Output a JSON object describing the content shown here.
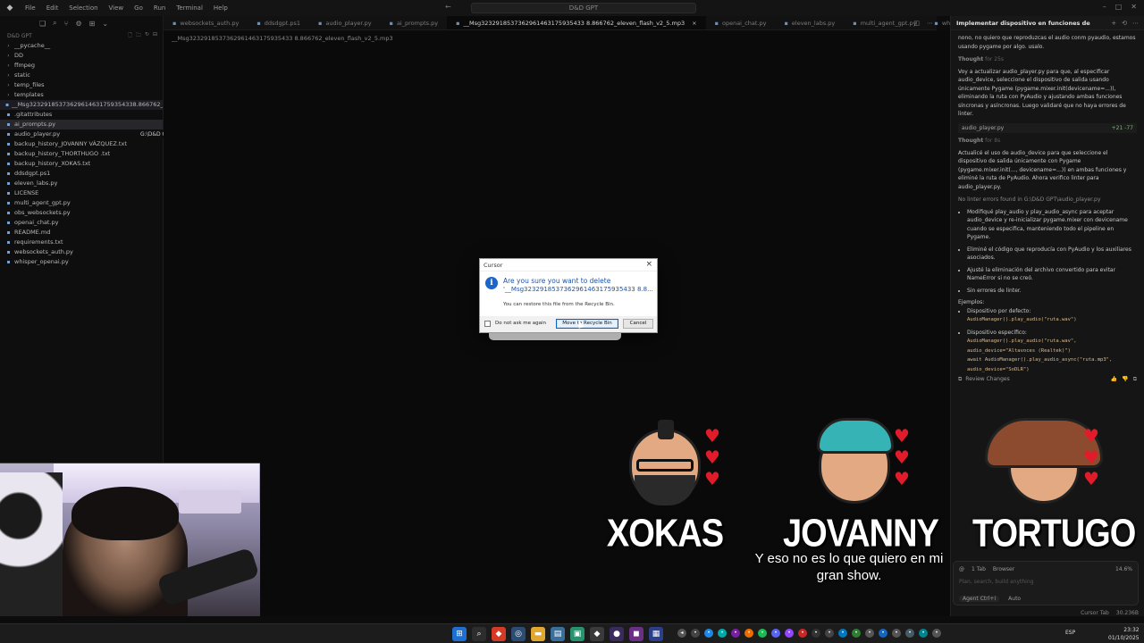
{
  "titlebar": {
    "menu": [
      "File",
      "Edit",
      "Selection",
      "View",
      "Go",
      "Run",
      "Terminal",
      "Help"
    ],
    "search": "D&D GPT"
  },
  "sidebar": {
    "header": "D&D GPT",
    "items": [
      {
        "label": "__pycache__",
        "type": "folder"
      },
      {
        "label": "DD",
        "type": "folder"
      },
      {
        "label": "ffmpeg",
        "type": "folder"
      },
      {
        "label": "static",
        "type": "folder"
      },
      {
        "label": "temp_files",
        "type": "folder"
      },
      {
        "label": "templates",
        "type": "folder"
      },
      {
        "label": "__Msg32329185373629614631759354338.866762_elev...",
        "type": "file",
        "state": "hl"
      },
      {
        "label": ".gitattributes",
        "type": "file"
      },
      {
        "label": "ai_prompts.py",
        "type": "file",
        "state": "sel"
      },
      {
        "label": "audio_player.py",
        "type": "file"
      },
      {
        "label": "backup_history_JOVANNY VÁZQUEZ.txt",
        "type": "file"
      },
      {
        "label": "backup_history_THORTHUGO .txt",
        "type": "file"
      },
      {
        "label": "backup_history_XOKAS.txt",
        "type": "file"
      },
      {
        "label": "ddsdgpt.ps1",
        "type": "file"
      },
      {
        "label": "eleven_labs.py",
        "type": "file"
      },
      {
        "label": "LICENSE",
        "type": "file"
      },
      {
        "label": "multi_agent_gpt.py",
        "type": "file"
      },
      {
        "label": "obs_websockets.py",
        "type": "file"
      },
      {
        "label": "openai_chat.py",
        "type": "file"
      },
      {
        "label": "README.md",
        "type": "file"
      },
      {
        "label": "requirements.txt",
        "type": "file"
      },
      {
        "label": "websockets_auth.py",
        "type": "file"
      },
      {
        "label": "whisper_openai.py",
        "type": "file"
      }
    ],
    "path_tooltip": "G:\\D&D GPT\\ai_prompts.py"
  },
  "tabs": [
    {
      "label": "websockets_auth.py",
      "active": false
    },
    {
      "label": "ddsdgpt.ps1",
      "active": false
    },
    {
      "label": "audio_player.py",
      "active": false
    },
    {
      "label": "ai_prompts.py",
      "active": false
    },
    {
      "label": "__Msg3232918537362961463175935433 8.866762_eleven_flash_v2_5.mp3",
      "active": true
    },
    {
      "label": "openai_chat.py",
      "active": false
    },
    {
      "label": "eleven_labs.py",
      "active": false
    },
    {
      "label": "multi_agent_gpt.py",
      "active": false
    },
    {
      "label": "whisper_openai.py",
      "active": false
    }
  ],
  "editor": {
    "breadcrumb": "__Msg3232918537362961463175935433 8.866762_eleven_flash_v2_5.mp3"
  },
  "dialog": {
    "title": "Cursor",
    "question": "Are you sure you want to delete",
    "filename": "'__Msg3232918537362961463175935433 8.8...",
    "note": "You can restore this file from the Recycle Bin.",
    "checkbox_label": "Do not ask me again",
    "primary_button": "Move to Recycle Bin",
    "cancel_button": "Cancel"
  },
  "chat": {
    "title": "Implementar dispositivo en funciones de au",
    "user_msg": "nono, no quiero que reproduzcas el audio conm pyaudio, estamos usando pygame por algo. usalo.",
    "thought1": "Thought",
    "thought1_time": "for 25s",
    "p1": "Voy a actualizar audio_player.py para que, al especificar audio_device, seleccione el dispositivo de salida usando únicamente Pygame (pygame.mixer.init(devicename=...)), eliminando la ruta con PyAudio y ajustando ambas funciones síncronas y asíncronas. Luego validaré que no haya errores de linter.",
    "file_pill": "audio_player.py",
    "file_diff": "+21 -77",
    "thought2": "Thought",
    "thought2_time": "for 8s",
    "p2": "Actualicé el uso de audio_device para que seleccione el dispositivo de salida únicamente con Pygame (pygame.mixer.init(..., devicename=...)) en ambas funciones y eliminé la ruta de PyAudio. Ahora verifico linter para audio_player.py.",
    "lint": "No linter errors found",
    "lint_path": "in G:\\D&D GPT\\audio_player.py",
    "bullets": [
      "Modifiqué play_audio y play_audio_async para aceptar audio_device y re-inicializar pygame.mixer con devicename cuando se especifica, manteniendo todo el pipeline en Pygame.",
      "Eliminé el código que reproducía con PyAudio y los auxiliares asociados.",
      "Ajusté la eliminación del archivo convertido para evitar NameError si no se creó.",
      "Sin errores de linter."
    ],
    "examples_label": "Ejemplos:",
    "ex1_label": "Dispositivo por defecto:",
    "ex1_code": "AudioManager().play_audio(\"ruta.wav\")",
    "ex2_label": "Dispositivo específico:",
    "ex2_code1": "AudioManager().play_audio(\"ruta.wav\", audio_device=\"Altavoces (Realtek)\")",
    "ex2_code2": "await AudioManager().play_audio_async(\"ruta.mp3\", audio_device=\"SoDLR\")",
    "review": "Review Changes",
    "composer": {
      "tab_count": "1 Tab",
      "browser": "Browser",
      "pct": "14.6%",
      "placeholder": "Plan, search, build anything",
      "agent": "Agent",
      "agent_key": "Ctrl+I",
      "model": "Auto"
    }
  },
  "overlay": {
    "chars": [
      "XOKAS",
      "JOVANNY",
      "TORTUGO"
    ],
    "subtitle": "Y eso no es lo que quiero en mi gran show."
  },
  "statusbar": {
    "left": "Cursor Tab",
    "right": "30.236B"
  },
  "taskbar": {
    "lang": "ESP",
    "time": "23:32",
    "date": "01/10/2025"
  }
}
